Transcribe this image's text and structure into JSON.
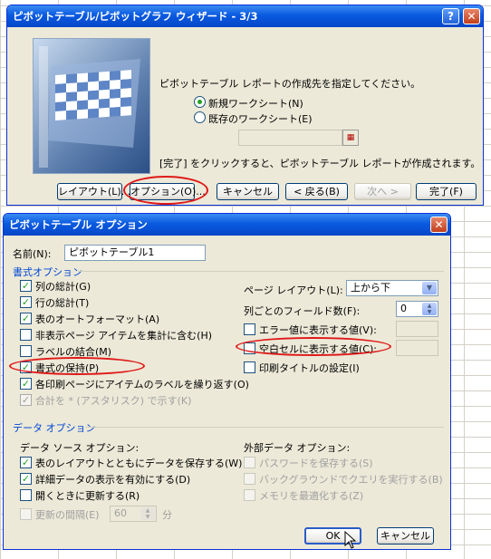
{
  "wizard": {
    "title": "ピボットテーブル/ピボットグラフ ウィザード - 3/3",
    "prompt": "ピボットテーブル レポートの作成先を指定してください。",
    "option_new_sheet": "新規ワークシート(N)",
    "option_existing_sheet": "既存のワークシート(E)",
    "finish_note": "[完了] をクリックすると、ピボットテーブル レポートが作成されます。",
    "btn_layout": "レイアウト(L)...",
    "btn_options": "オプション(O)...",
    "btn_cancel": "キャンセル",
    "btn_back": "< 戻る(B)",
    "btn_next": "次へ >",
    "btn_finish": "完了(F)"
  },
  "dialog": {
    "title": "ピボットテーブル オプション",
    "name_label": "名前(N):",
    "name_value": "ピボットテーブル1",
    "format_section": "書式オプション",
    "format_left": [
      {
        "label": "列の総計(G)",
        "checked": true,
        "disabled": false
      },
      {
        "label": "行の総計(T)",
        "checked": true,
        "disabled": false
      },
      {
        "label": "表のオートフォーマット(A)",
        "checked": true,
        "disabled": false
      },
      {
        "label": "非表示ページ アイテムを集計に含む(H)",
        "checked": false,
        "disabled": false
      },
      {
        "label": "ラベルの結合(M)",
        "checked": false,
        "disabled": false
      },
      {
        "label": "書式の保持(P)",
        "checked": true,
        "disabled": false
      },
      {
        "label": "各印刷ページにアイテムのラベルを繰り返す(O)",
        "checked": true,
        "disabled": false
      },
      {
        "label": "合計を * (アスタリスク) で示す(K)",
        "checked": true,
        "disabled": true
      }
    ],
    "page_layout_label": "ページ レイアウト(L):",
    "page_layout_value": "上から下",
    "fields_per_col_label": "列ごとのフィールド数(F):",
    "fields_per_col_value": "0",
    "error_value_label": "エラー値に表示する値(V):",
    "empty_cell_label": "空白セルに表示する値(C):",
    "print_titles_label": "印刷タイトルの設定(I)",
    "data_section": "データ オプション",
    "data_source_header": "データ ソース オプション:",
    "data_source_items": [
      {
        "label": "表のレイアウトとともにデータを保存する(W)",
        "checked": true,
        "disabled": false
      },
      {
        "label": "詳細データの表示を有効にする(D)",
        "checked": true,
        "disabled": false
      },
      {
        "label": "開くときに更新する(R)",
        "checked": false,
        "disabled": false
      }
    ],
    "refresh_label": "更新の間隔(E)",
    "refresh_value": "60",
    "refresh_unit": "分",
    "external_header": "外部データ オプション:",
    "external_items": [
      {
        "label": "パスワードを保存する(S)",
        "checked": false,
        "disabled": true
      },
      {
        "label": "バックグラウンドでクエリを実行する(B)",
        "checked": false,
        "disabled": true
      },
      {
        "label": "メモリを最適化する(Z)",
        "checked": false,
        "disabled": true
      }
    ],
    "btn_ok": "OK",
    "btn_cancel": "キャンセル"
  },
  "colors": {
    "highlight_ellipse": "#e01818",
    "section_text": "#0046d5",
    "titlebar": "#0a5ae0"
  }
}
